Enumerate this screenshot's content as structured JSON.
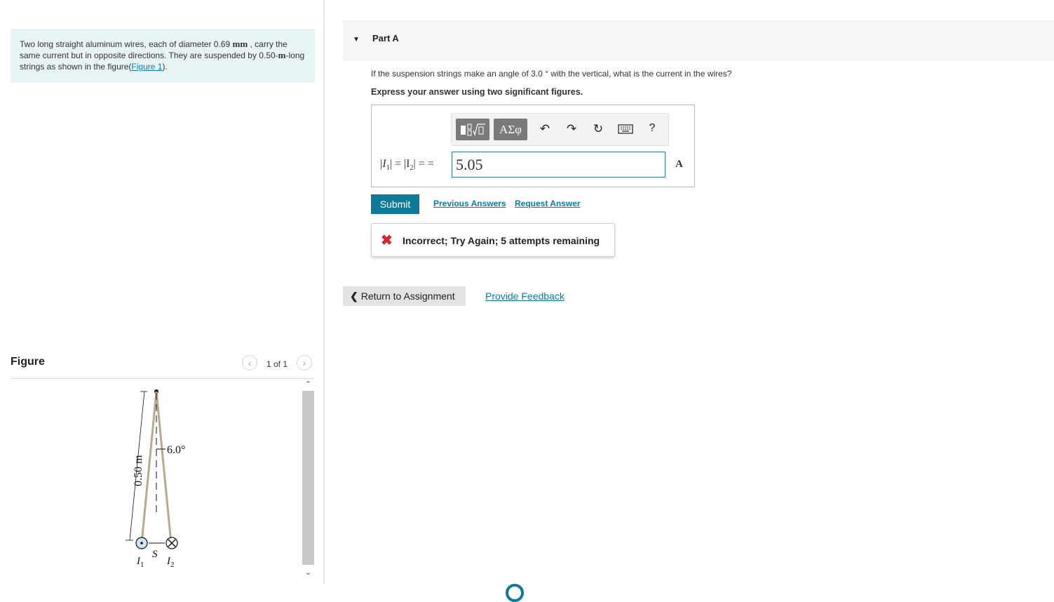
{
  "problem": {
    "text_before_unit": "Two long straight aluminum wires, each of diameter 0.69 ",
    "diameter_unit": "mm",
    "text_mid": " , carry the same current but in opposite directions. They are suspended by 0.50-",
    "length_unit": "m",
    "text_after_unit": "-long strings as shown in the figure(",
    "figure_link": "Figure 1",
    "text_end": ")."
  },
  "figure": {
    "title": "Figure",
    "pager_text": "1 of 1",
    "length_label": "0.50 m",
    "angle_label": "6.0°",
    "separation_label": "S",
    "current1_label": "I",
    "current1_sub": "1",
    "current2_label": "I",
    "current2_sub": "2"
  },
  "part": {
    "title": "Part A",
    "question": "If the suspension strings make an angle of 3.0 ° with the vertical, what is the current in the wires?",
    "instruction": "Express your answer using two significant figures.",
    "toolbar": {
      "symbols_label": "ΑΣφ",
      "help_label": "?"
    },
    "math_prefix": "|I",
    "math_sub1": "1",
    "math_mid": "| = |I",
    "math_sub2": "2",
    "math_suffix": "| = =",
    "answer_value": "5.05",
    "unit": "A",
    "submit_label": "Submit",
    "previous_answers": "Previous Answers",
    "request_answer": "Request Answer",
    "feedback": "Incorrect; Try Again; 5 attempts remaining"
  },
  "footer": {
    "return_label": "Return to Assignment",
    "provide_feedback": "Provide Feedback"
  },
  "colors": {
    "accent": "#0f7a97",
    "link": "#0c7ba6",
    "error": "#d6262b",
    "problem_bg": "#e8f4f6"
  }
}
